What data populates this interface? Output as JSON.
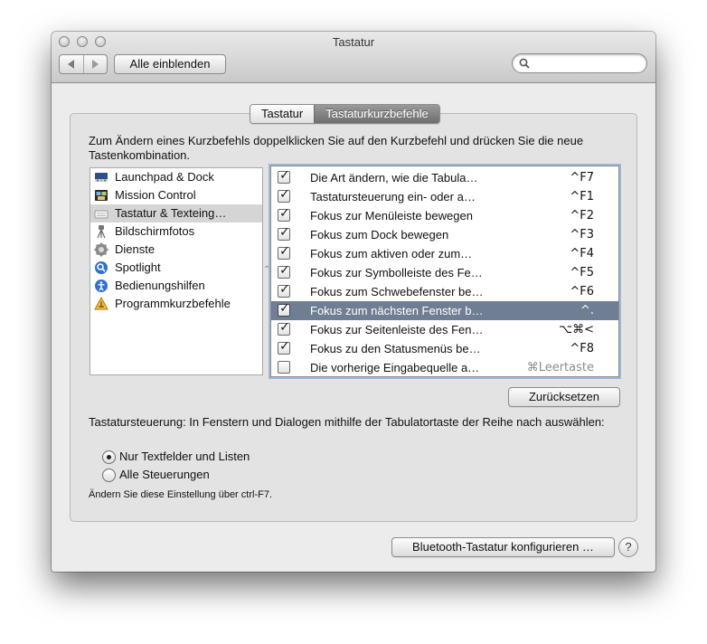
{
  "window": {
    "title": "Tastatur"
  },
  "toolbar": {
    "show_all_label": "Alle einblenden",
    "search_placeholder": ""
  },
  "tabs": [
    {
      "label": "Tastatur",
      "active": false
    },
    {
      "label": "Tastaturkurzbefehle",
      "active": true
    }
  ],
  "instruction": "Zum Ändern eines Kurzbefehls doppelklicken Sie auf den Kurzbefehl und drücken Sie die neue Tastenkombination.",
  "categories": [
    {
      "label": "Launchpad & Dock",
      "icon": "launchpad-dock-icon",
      "selected": false
    },
    {
      "label": "Mission Control",
      "icon": "mission-control-icon",
      "selected": false
    },
    {
      "label": "Tastatur & Texteing…",
      "icon": "keyboard-text-icon",
      "selected": true
    },
    {
      "label": "Bildschirmfotos",
      "icon": "screenshot-icon",
      "selected": false
    },
    {
      "label": "Dienste",
      "icon": "services-gear-icon",
      "selected": false
    },
    {
      "label": "Spotlight",
      "icon": "spotlight-icon",
      "selected": false
    },
    {
      "label": "Bedienungshilfen",
      "icon": "accessibility-icon",
      "selected": false
    },
    {
      "label": "Programmkurzbefehle",
      "icon": "app-shortcuts-icon",
      "selected": false
    }
  ],
  "shortcuts": [
    {
      "label": "Die Art ändern, wie die Tabula…",
      "key": "^F7",
      "checked": true
    },
    {
      "label": "Tastatursteuerung ein- oder a…",
      "key": "^F1",
      "checked": true
    },
    {
      "label": "Fokus zur Menüleiste bewegen",
      "key": "^F2",
      "checked": true
    },
    {
      "label": "Fokus zum Dock bewegen",
      "key": "^F3",
      "checked": true
    },
    {
      "label": "Fokus zum aktiven oder zum…",
      "key": "^F4",
      "checked": true
    },
    {
      "label": "Fokus zur Symbolleiste des Fe…",
      "key": "^F5",
      "checked": true
    },
    {
      "label": "Fokus zum Schwebefenster be…",
      "key": "^F6",
      "checked": true
    },
    {
      "label": "Fokus zum nächsten Fenster b…",
      "key": "^.",
      "checked": true,
      "selected": true
    },
    {
      "label": "Fokus zur Seitenleiste des Fen…",
      "key": "⌥⌘<",
      "checked": true
    },
    {
      "label": "Fokus zu den Statusmenüs be…",
      "key": "^F8",
      "checked": true
    },
    {
      "label": "Die vorherige Eingabequelle a…",
      "key": "⌘Leertaste",
      "checked": false,
      "disabled": true
    }
  ],
  "reset_label": "Zurücksetzen",
  "tab_control": {
    "text": "Tastatursteuerung: In Fenstern und Dialogen mithilfe der Tabulatortaste der Reihe nach auswählen:",
    "options": [
      {
        "label": "Nur Textfelder und Listen",
        "selected": true
      },
      {
        "label": "Alle Steuerungen",
        "selected": false
      }
    ],
    "note": "Ändern Sie diese Einstellung über ctrl-F7."
  },
  "bluetooth_label": "Bluetooth-Tastatur konfigurieren …",
  "help_label": "?",
  "colors": {
    "selection": "#6f7e93",
    "focus_ring": "#9fb8d6"
  }
}
